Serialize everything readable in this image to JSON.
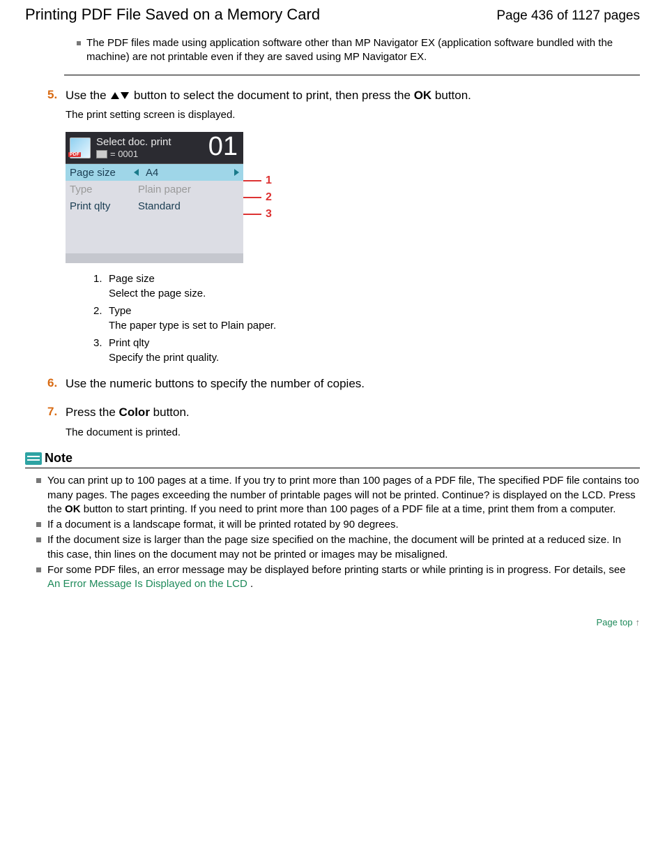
{
  "header": {
    "title": "Printing PDF File Saved on a Memory Card",
    "page_indicator": "Page 436 of 1127 pages"
  },
  "top_note_items": [
    "The PDF files made using application software other than MP Navigator EX (application software bundled with the machine) are not printable even if they are saved using MP Navigator EX."
  ],
  "step5": {
    "num": "5.",
    "pre": "Use the ",
    "mid": " button to select the document to print, then press the ",
    "ok": "OK",
    "post": " button.",
    "sub": "The print setting screen is displayed."
  },
  "lcd": {
    "title": "Select doc. print",
    "counter_prefix": "= 0001",
    "copies": "01",
    "rows": {
      "r1": {
        "k": "Page size",
        "v": "A4",
        "call": "1"
      },
      "r2": {
        "k": "Type",
        "v": "Plain paper",
        "call": "2"
      },
      "r3": {
        "k": "Print qlty",
        "v": "Standard",
        "call": "3"
      }
    }
  },
  "sublist": [
    {
      "n": "1.",
      "t": "Page size",
      "d": "Select the page size."
    },
    {
      "n": "2.",
      "t": "Type",
      "d": "The paper type is set to Plain paper."
    },
    {
      "n": "3.",
      "t": "Print qlty",
      "d": "Specify the print quality."
    }
  ],
  "step6": {
    "num": "6.",
    "text": "Use the numeric buttons to specify the number of copies."
  },
  "step7": {
    "num": "7.",
    "pre": "Press the ",
    "btn": "Color",
    "post": " button.",
    "sub": "The document is printed."
  },
  "notehead": "Note",
  "notes": {
    "n1_a": "You can print up to 100 pages at a time. If you try to print more than 100 pages of a PDF file, The specified PDF file contains too many pages. The pages exceeding the number of printable pages will not be printed. Continue? is displayed on the LCD. Press the  ",
    "n1_ok": "OK",
    "n1_b": " button to start printing. If you need to print more than 100 pages of a PDF file at a time, print them from a computer.",
    "n2": "If a document is a landscape format, it will be printed rotated by 90 degrees.",
    "n3": "If the document size is larger than the page size specified on the machine, the document will be printed at a reduced size. In this case, thin lines on the document may not be printed or images may be misaligned.",
    "n4_a": "For some PDF files, an error message may be displayed before printing starts or while printing is in progress. For details, see ",
    "n4_link": "An Error Message Is Displayed on the LCD",
    "n4_b": " ."
  },
  "pagetop": "Page top"
}
